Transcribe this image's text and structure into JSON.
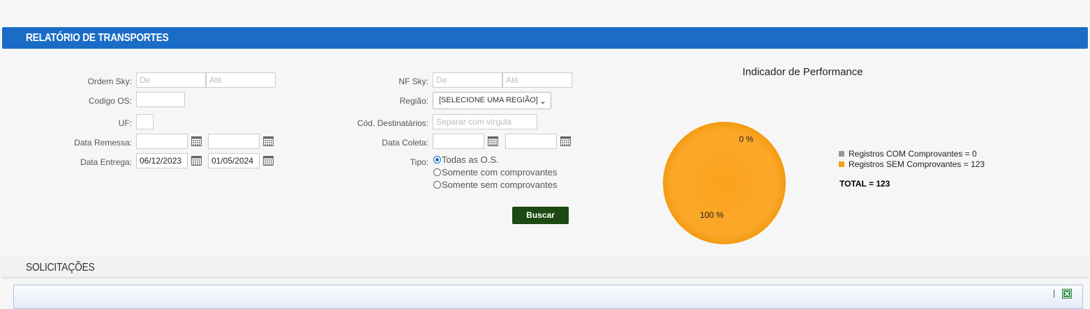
{
  "header": {
    "title": "RELATÓRIO DE TRANSPORTES"
  },
  "form": {
    "ordem_sky": {
      "label": "Ordem Sky:",
      "from_placeholder": "De",
      "to_placeholder": "Atè"
    },
    "codigo_os": {
      "label": "Codigo OS:"
    },
    "uf": {
      "label": "UF:"
    },
    "data_remessa": {
      "label": "Data Remessa:"
    },
    "data_entrega": {
      "label": "Data Entrega:",
      "from_value": "06/12/2023",
      "to_value": "01/05/2024"
    },
    "nf_sky": {
      "label": "NF Sky:",
      "from_placeholder": "De",
      "to_placeholder": "Atè"
    },
    "regiao": {
      "label": "Região:",
      "selected": "[SELECIONE UMA REGIÃO]"
    },
    "cod_destinatarios": {
      "label": "Cód. Destinatários:",
      "placeholder": "Separar com vírgula"
    },
    "data_coleta": {
      "label": "Data Coleta:"
    },
    "tipo": {
      "label": "Tipo:",
      "options": [
        "Todas as O.S.",
        "Somente com comprovantes",
        "Somente sem comprovantes"
      ],
      "selected_index": 0
    },
    "search_button": "Buscar"
  },
  "chart_data": {
    "type": "pie",
    "title": "Indicador de Performance",
    "categories": [
      "Registros COM Comprovantes = 0",
      "Registros SEM Comprovantes = 123"
    ],
    "values": [
      0,
      123
    ],
    "slice_labels": [
      "0 %",
      "100 %"
    ],
    "colors": [
      "#999999",
      "#f7a017"
    ],
    "total_label": "TOTAL = 123",
    "legend_position": "right"
  },
  "section2": {
    "title": "SOLICITAÇÕES"
  },
  "icons": {
    "calendar": "calendar-icon",
    "excel": "excel-export-icon",
    "dropdown": "chevron-down-icon"
  }
}
